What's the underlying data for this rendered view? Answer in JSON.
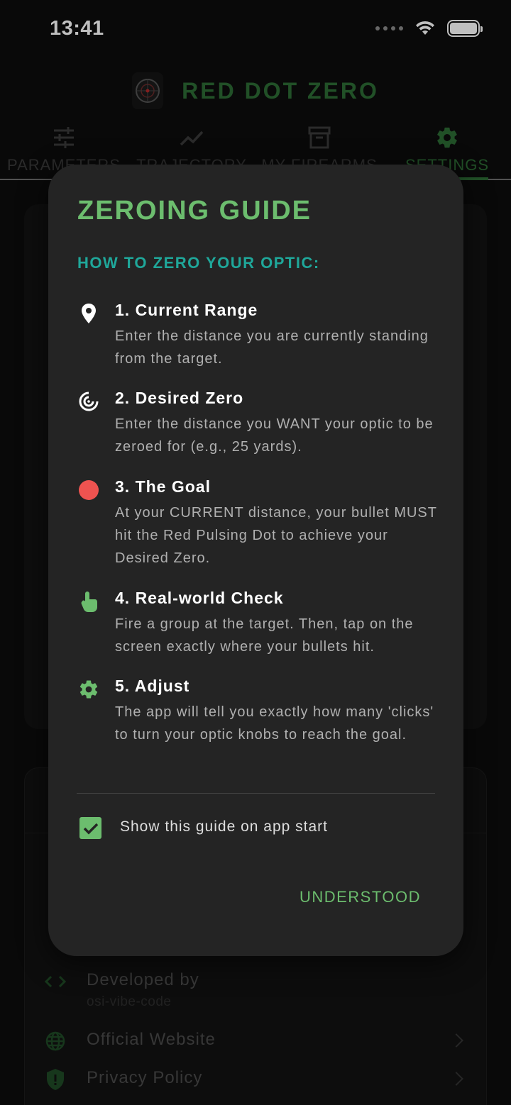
{
  "status_bar": {
    "time": "13:41"
  },
  "header": {
    "title": "RED DOT ZERO",
    "logo_icon": "red-dot-reticle-icon"
  },
  "tabs": [
    {
      "label": "PARAMETERS",
      "icon": "sliders-icon",
      "active": false
    },
    {
      "label": "TRAJECTORY",
      "icon": "trend-line-icon",
      "active": false
    },
    {
      "label": "MY FIREARMS",
      "icon": "archive-box-icon",
      "active": false
    },
    {
      "label": "SETTINGS",
      "icon": "gear-icon",
      "active": true
    }
  ],
  "background": {
    "developed_by_label": "Developed by",
    "developer_name": "osi-vibe-code",
    "official_website_label": "Official Website",
    "privacy_policy_label": "Privacy Policy"
  },
  "dialog": {
    "title": "ZEROING GUIDE",
    "subtitle": "HOW TO ZERO YOUR OPTIC:",
    "steps": [
      {
        "icon": "map-pin-icon",
        "title": "1. Current Range",
        "description": "Enter the distance you are currently standing from the target."
      },
      {
        "icon": "target-icon",
        "title": "2. Desired Zero",
        "description": "Enter the distance you WANT your optic to be zeroed for (e.g., 25 yards)."
      },
      {
        "icon": "red-dot-icon",
        "title": "3. The Goal",
        "description": "At your CURRENT distance, your bullet MUST hit the Red Pulsing Dot to achieve your Desired Zero."
      },
      {
        "icon": "tap-hand-icon",
        "title": "4. Real-world Check",
        "description": "Fire a group at the target. Then, tap on the screen exactly where your bullets hit."
      },
      {
        "icon": "gear-icon",
        "title": "5. Adjust",
        "description": "The app will tell you exactly how many 'clicks' to turn your optic knobs to reach the goal."
      }
    ],
    "show_on_start_label": "Show this guide on app start",
    "show_on_start_checked": true,
    "confirm_label": "UNDERSTOOD"
  },
  "colors": {
    "accent_green": "#6cbd6e",
    "subtitle_teal": "#1fa79a",
    "goal_red": "#ef5350",
    "dialog_bg": "#242424"
  }
}
